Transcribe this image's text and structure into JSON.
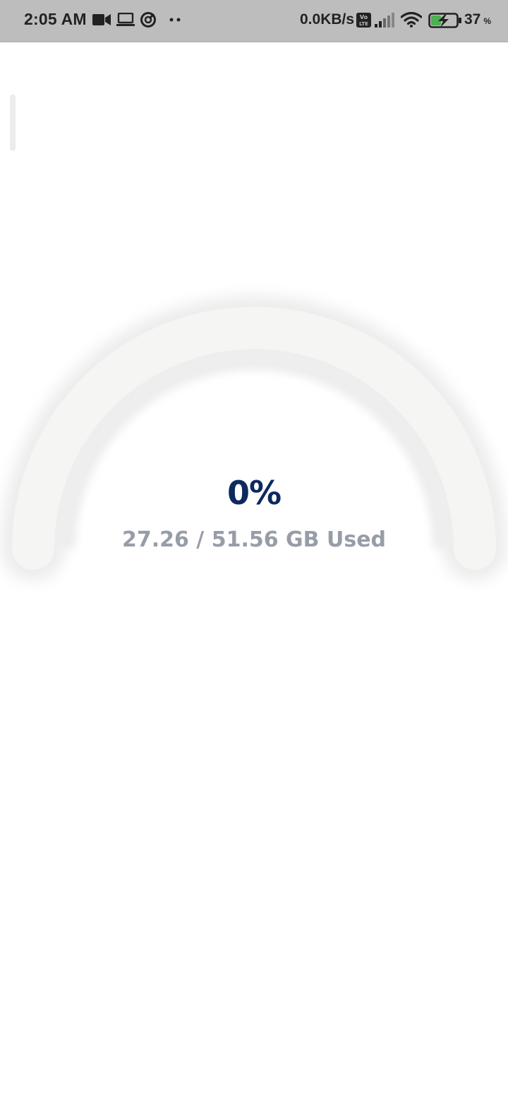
{
  "status_bar": {
    "time": "2:05 AM",
    "net_speed": "0.0KB/s",
    "battery_value": "37",
    "battery_unit": "%",
    "icons": [
      "video-camera-icon",
      "laptop-icon",
      "data-saver-icon",
      "more-dots-icon",
      "volte-icon",
      "signal-icon",
      "wifi-icon",
      "battery-charging-icon"
    ]
  },
  "storage": {
    "percent_label": "0%",
    "percent_value": 0,
    "usage_label": "27.26 / 51.56 GB Used"
  },
  "colors": {
    "percent_text": "#0d2a5e",
    "usage_text": "#979da8",
    "track": "#f5f5f3",
    "status_bar_bg": "#bdbdbd",
    "battery_green": "#4caf50"
  }
}
